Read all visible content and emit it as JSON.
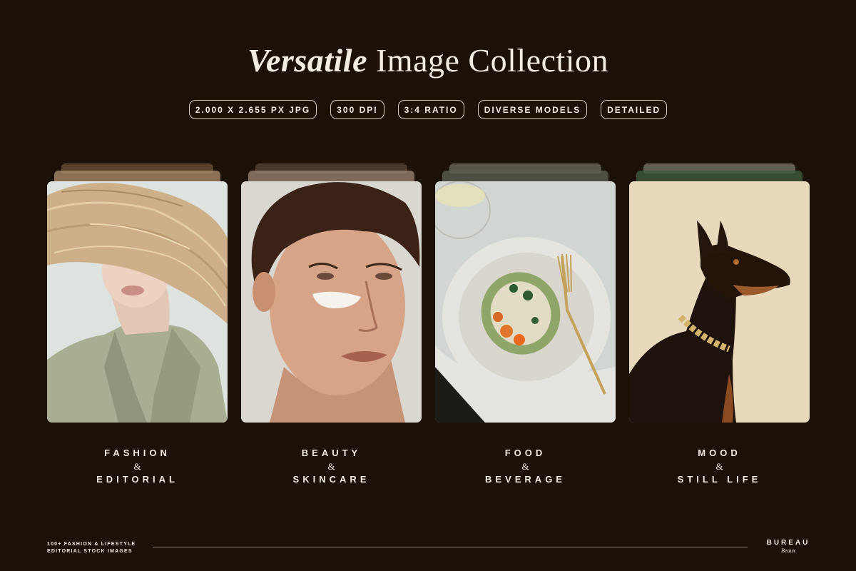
{
  "header": {
    "title_em": "Versatile",
    "title_rest": " Image Collection"
  },
  "tags": [
    "2.000 X 2.655 PX JPG",
    "300 DPI",
    "3:4 RATIO",
    "DIVERSE MODELS",
    "DETAILED"
  ],
  "categories": [
    {
      "line1": "FASHION",
      "amp": "&",
      "line2": "EDITORIAL"
    },
    {
      "line1": "BEAUTY",
      "amp": "&",
      "line2": "SKINCARE"
    },
    {
      "line1": "FOOD",
      "amp": "&",
      "line2": "BEVERAGE"
    },
    {
      "line1": "MOOD",
      "amp": "&",
      "line2": "STILL LIFE"
    }
  ],
  "footer": {
    "left_line1": "100+ FASHION & LIFESTYLE",
    "left_line2": "EDITORIAL STOCK IMAGES",
    "brand_name": "BUREAU",
    "brand_sub": "Beaux"
  },
  "colors": {
    "background": "#1b1107",
    "text": "#f3ece0"
  }
}
